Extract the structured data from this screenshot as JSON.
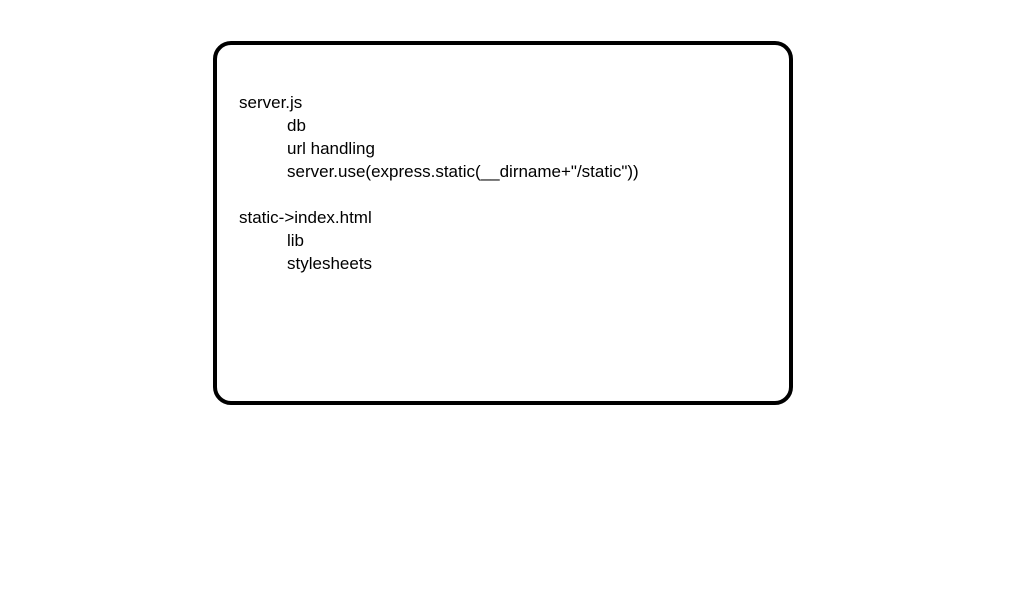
{
  "notes": {
    "server_file": "server.js",
    "server_items": [
      "db",
      "url handling",
      "server.use(express.static(__dirname+\"/static\"))"
    ],
    "static_path": "static->index.html",
    "static_items": [
      "lib",
      "stylesheets"
    ]
  }
}
